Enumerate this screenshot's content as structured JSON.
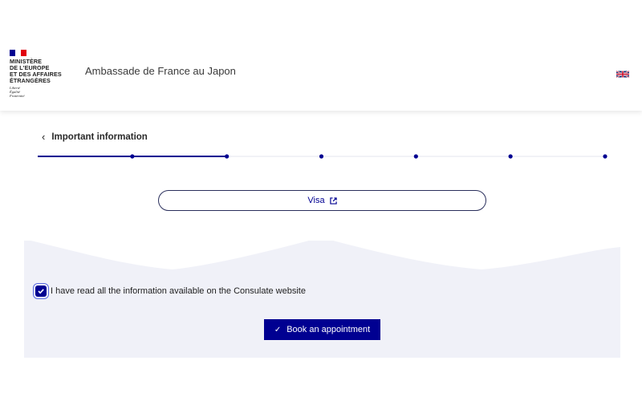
{
  "header": {
    "logo": {
      "lines": [
        "MINISTÈRE",
        "DE L'EUROPE",
        "ET DES AFFAIRES",
        "ÉTRANGÈRES"
      ],
      "motto": [
        "Liberté",
        "Égalité",
        "Fraternité"
      ],
      "flag_colors": [
        "#000091",
        "#ffffff",
        "#e1000f"
      ]
    },
    "site_title": "Ambassade de France au Japon",
    "language_icon": "uk-flag-icon"
  },
  "form": {
    "back_label": "Important information",
    "back_icon": "chevron-left-icon",
    "stepper": {
      "total_steps": 7,
      "completed_fraction": 0.333
    },
    "visa_button_label": "Visa",
    "visa_icon": "external-link-icon",
    "consent_label": "I have read all the information available on the Consulate website",
    "consent_checked": true,
    "submit_label": "Book an appointment",
    "submit_icon": "check-icon"
  },
  "colors": {
    "primary": "#000091",
    "card_bg": "#f0f1f8"
  }
}
